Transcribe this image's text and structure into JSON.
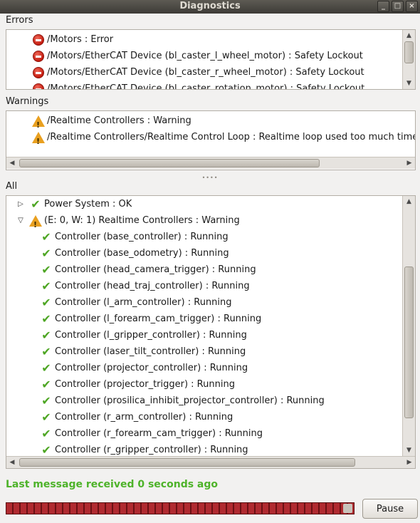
{
  "window": {
    "title": "Diagnostics",
    "buttons": [
      "_",
      "□",
      "×"
    ]
  },
  "errors": {
    "label": "Errors",
    "items": [
      {
        "icon": "error-icon",
        "text": "/Motors : Error"
      },
      {
        "icon": "error-icon",
        "text": "/Motors/EtherCAT Device (bl_caster_l_wheel_motor) : Safety Lockout"
      },
      {
        "icon": "error-icon",
        "text": "/Motors/EtherCAT Device (bl_caster_r_wheel_motor) : Safety Lockout"
      },
      {
        "icon": "error-icon",
        "text": "/Motors/EtherCAT Device (bl_caster_rotation_motor) : Safety Lockout"
      }
    ]
  },
  "warnings": {
    "label": "Warnings",
    "items": [
      {
        "icon": "warning-icon",
        "text": "/Realtime Controllers : Warning"
      },
      {
        "icon": "warning-icon",
        "text": "/Realtime Controllers/Realtime Control Loop : Realtime loop used too much time"
      }
    ]
  },
  "all": {
    "label": "All",
    "items": [
      {
        "expander": "▷",
        "icon": "ok-icon",
        "text": "Power System : OK",
        "level": 0
      },
      {
        "expander": "▽",
        "icon": "warning-icon",
        "text": "(E: 0, W: 1) Realtime Controllers : Warning",
        "level": 0
      },
      {
        "icon": "ok-icon",
        "text": "Controller (base_controller) : Running",
        "level": 1
      },
      {
        "icon": "ok-icon",
        "text": "Controller (base_odometry) : Running",
        "level": 1
      },
      {
        "icon": "ok-icon",
        "text": "Controller (head_camera_trigger) : Running",
        "level": 1
      },
      {
        "icon": "ok-icon",
        "text": "Controller (head_traj_controller) : Running",
        "level": 1
      },
      {
        "icon": "ok-icon",
        "text": "Controller (l_arm_controller) : Running",
        "level": 1
      },
      {
        "icon": "ok-icon",
        "text": "Controller (l_forearm_cam_trigger) : Running",
        "level": 1
      },
      {
        "icon": "ok-icon",
        "text": "Controller (l_gripper_controller) : Running",
        "level": 1
      },
      {
        "icon": "ok-icon",
        "text": "Controller (laser_tilt_controller) : Running",
        "level": 1
      },
      {
        "icon": "ok-icon",
        "text": "Controller (projector_controller) : Running",
        "level": 1
      },
      {
        "icon": "ok-icon",
        "text": "Controller (projector_trigger) : Running",
        "level": 1
      },
      {
        "icon": "ok-icon",
        "text": "Controller (prosilica_inhibit_projector_controller) : Running",
        "level": 1
      },
      {
        "icon": "ok-icon",
        "text": "Controller (r_arm_controller) : Running",
        "level": 1
      },
      {
        "icon": "ok-icon",
        "text": "Controller (r_forearm_cam_trigger) : Running",
        "level": 1
      },
      {
        "icon": "ok-icon",
        "text": "Controller (r_gripper_controller) : Running",
        "level": 1
      }
    ]
  },
  "status": {
    "message": "Last message received 0 seconds ago",
    "color": "#4eb32a"
  },
  "controls": {
    "pause_label": "Pause"
  },
  "colors": {
    "error": "#c41c10",
    "warning": "#e9a020",
    "ok": "#4ea624",
    "progress": "#8a1a1e"
  }
}
